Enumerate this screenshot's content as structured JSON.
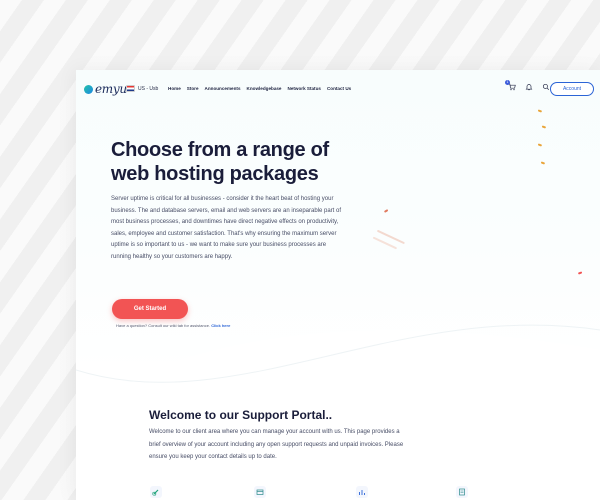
{
  "brand": {
    "logo_text": "emyu"
  },
  "nav": {
    "locale": "US - Usb",
    "items": [
      "Home",
      "Store",
      "Announcements",
      "Knowledgebase",
      "Network Status",
      "Contact Us"
    ],
    "cart_count": "1",
    "account_label": "Account"
  },
  "hero": {
    "title": "Choose from a range of web hosting packages",
    "text": "Server uptime is critical for all businesses - consider it the heart beat of hosting your business. The and database servers, email and web servers are an inseparable part of most business processes, and downtimes have direct negative effects on productivity, sales, employee and customer satisfaction. That's why ensuring the maximum server uptime is so important to us - we want to make sure your business processes are running healthy so your customers are happy.",
    "cta_label": "Get Started",
    "note_text": "Have a question? Consult our wiki tab for assistance.",
    "note_link": "Click here"
  },
  "support": {
    "title": "Welcome to our Support Portal..",
    "text": "Welcome to our client area where you can manage your account with us. This page provides a brief overview of your account including any open support requests and unpaid invoices. Please ensure you keep your contact details up to date."
  },
  "colors": {
    "accent": "#2b64d6",
    "cta": "#f25454",
    "heading": "#1a1d3a"
  }
}
